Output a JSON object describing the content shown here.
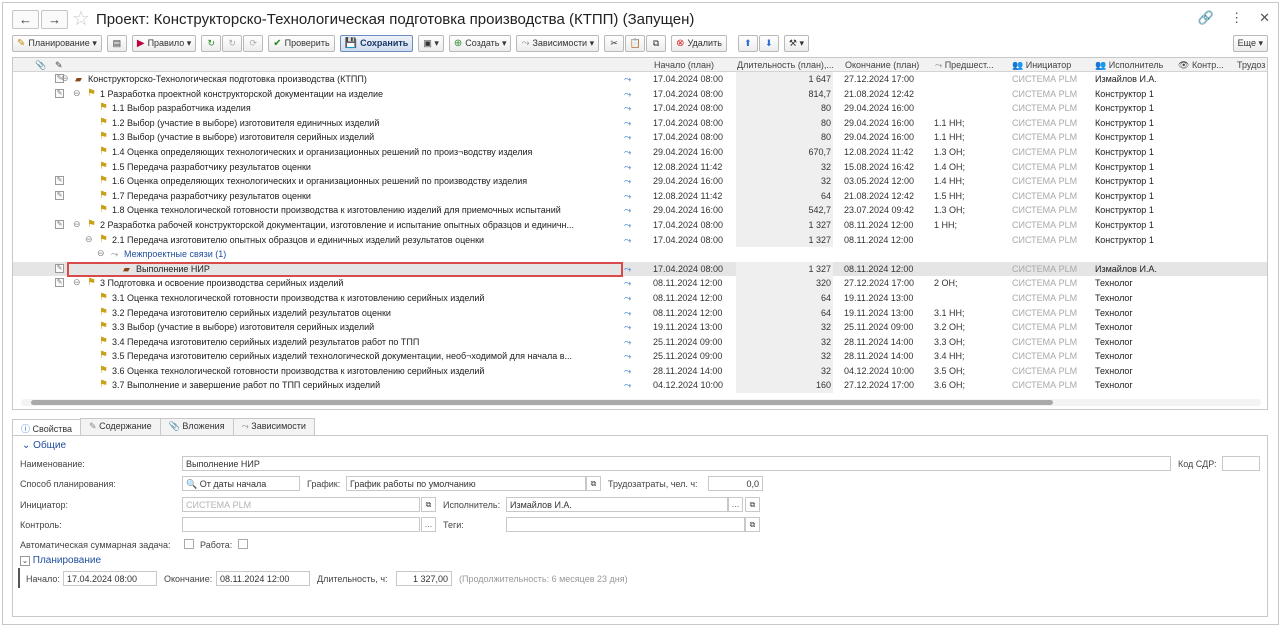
{
  "title": "Проект: Конструкторско-Технологическая подготовка производства (КТПП) (Запущен)",
  "toolbar": {
    "planning": "Планирование",
    "rule": "Правило",
    "check": "Проверить",
    "save": "Сохранить",
    "create": "Создать",
    "deps": "Зависимости",
    "delete": "Удалить",
    "more": "Еще"
  },
  "columns": {
    "start": "Начало (план)",
    "duration": "Длительность (план),...",
    "end": "Окончание (план)",
    "pred": "Предшест...",
    "initiator": "Инициатор",
    "executor": "Исполнитель",
    "control": "Контр...",
    "labor": "Трудоз"
  },
  "rows": [
    {
      "name": "Конструкторско-Технологическая подготовка производства (КТПП)",
      "start": "17.04.2024 08:00",
      "duration": "1 647",
      "end": "27.12.2024 17:00",
      "pred": "",
      "initiator": "СИСТЕМА PLM",
      "executor": "Измайлов И.А."
    },
    {
      "name": "1 Разработка проектной конструкторской документации на изделие",
      "start": "17.04.2024 08:00",
      "duration": "814,7",
      "end": "21.08.2024 12:42",
      "pred": "",
      "initiator": "СИСТЕМА PLM",
      "executor": "Конструктор 1"
    },
    {
      "name": "1.1 Выбор разработчика изделия",
      "start": "17.04.2024 08:00",
      "duration": "80",
      "end": "29.04.2024 16:00",
      "pred": "",
      "initiator": "СИСТЕМА PLM",
      "executor": "Конструктор 1"
    },
    {
      "name": "1.2 Выбор (участие в выборе) изготовителя единичных изделий",
      "start": "17.04.2024 08:00",
      "duration": "80",
      "end": "29.04.2024 16:00",
      "pred": "1.1 НН;",
      "initiator": "СИСТЕМА PLM",
      "executor": "Конструктор 1"
    },
    {
      "name": "1.3 Выбор (участие в выборе) изготовителя серийных изделий",
      "start": "17.04.2024 08:00",
      "duration": "80",
      "end": "29.04.2024 16:00",
      "pred": "1.1 НН;",
      "initiator": "СИСТЕМА PLM",
      "executor": "Конструктор 1"
    },
    {
      "name": "1.4 Оценка определяющих технологических и организационных решений по произ¬водству изделия",
      "start": "29.04.2024 16:00",
      "duration": "670,7",
      "end": "12.08.2024 11:42",
      "pred": "1.3 ОН;",
      "initiator": "СИСТЕМА PLM",
      "executor": "Конструктор 1"
    },
    {
      "name": "1.5 Передача разработчику результатов оценки",
      "start": "12.08.2024 11:42",
      "duration": "32",
      "end": "15.08.2024 16:42",
      "pred": "1.4 ОН;",
      "initiator": "СИСТЕМА PLM",
      "executor": "Конструктор 1"
    },
    {
      "name": "1.6 Оценка определяющих технологических и организационных решений по производству изделия",
      "start": "29.04.2024 16:00",
      "duration": "32",
      "end": "03.05.2024 12:00",
      "pred": "1.4 НН;",
      "initiator": "СИСТЕМА PLM",
      "executor": "Конструктор 1"
    },
    {
      "name": "1.7 Передача разработчику результатов оценки",
      "start": "12.08.2024 11:42",
      "duration": "64",
      "end": "21.08.2024 12:42",
      "pred": "1.5 НН;",
      "initiator": "СИСТЕМА PLM",
      "executor": "Конструктор 1"
    },
    {
      "name": "1.8 Оценка технологической готовности производства к изготовлению изделий для приемочных испытаний",
      "start": "29.04.2024 16:00",
      "duration": "542,7",
      "end": "23.07.2024 09:42",
      "pred": "1.3 ОН;",
      "initiator": "СИСТЕМА PLM",
      "executor": "Конструктор 1"
    },
    {
      "name": "2 Разработка рабочей конструкторской документации, изготовление и испытание опытных образцов и единичн...",
      "start": "17.04.2024 08:00",
      "duration": "1 327",
      "end": "08.11.2024 12:00",
      "pred": "1 НН;",
      "initiator": "СИСТЕМА PLM",
      "executor": "Конструктор 1"
    },
    {
      "name": "2.1 Передача изготовителю опытных образцов и единичных изделий результатов оценки",
      "start": "17.04.2024 08:00",
      "duration": "1 327",
      "end": "08.11.2024 12:00",
      "pred": "",
      "initiator": "СИСТЕМА PLM",
      "executor": "Конструктор 1"
    },
    {
      "name": "Межпроектные связи (1)",
      "start": "",
      "duration": "",
      "end": "",
      "pred": "",
      "initiator": "",
      "executor": ""
    },
    {
      "name": "Выполнение НИР",
      "start": "17.04.2024 08:00",
      "duration": "1 327",
      "end": "08.11.2024 12:00",
      "pred": "",
      "initiator": "СИСТЕМА PLM",
      "executor": "Измайлов И.А."
    },
    {
      "name": "3 Подготовка и освоение производства серийных изделий",
      "start": "08.11.2024 12:00",
      "duration": "320",
      "end": "27.12.2024 17:00",
      "pred": "2 ОН;",
      "initiator": "СИСТЕМА PLM",
      "executor": "Технолог"
    },
    {
      "name": "3.1 Оценка технологической готовности производства к изготовлению серийных изделий",
      "start": "08.11.2024 12:00",
      "duration": "64",
      "end": "19.11.2024 13:00",
      "pred": "",
      "initiator": "СИСТЕМА PLM",
      "executor": "Технолог"
    },
    {
      "name": "3.2 Передача изготовителю серийных изделий результатов оценки",
      "start": "08.11.2024 12:00",
      "duration": "64",
      "end": "19.11.2024 13:00",
      "pred": "3.1 НН;",
      "initiator": "СИСТЕМА PLM",
      "executor": "Технолог"
    },
    {
      "name": "3.3 Выбор (участие в выборе) изготовителя серийных изделий",
      "start": "19.11.2024 13:00",
      "duration": "32",
      "end": "25.11.2024 09:00",
      "pred": "3.2 ОН;",
      "initiator": "СИСТЕМА PLM",
      "executor": "Технолог"
    },
    {
      "name": "3.4 Передача изготовителю серийных изделий результатов работ по ТПП",
      "start": "25.11.2024 09:00",
      "duration": "32",
      "end": "28.11.2024 14:00",
      "pred": "3.3 ОН;",
      "initiator": "СИСТЕМА PLM",
      "executor": "Технолог"
    },
    {
      "name": "3.5 Передача изготовителю серийных изделий технологической документации, необ¬ходимой для начала в...",
      "start": "25.11.2024 09:00",
      "duration": "32",
      "end": "28.11.2024 14:00",
      "pred": "3.4 НН;",
      "initiator": "СИСТЕМА PLM",
      "executor": "Технолог"
    },
    {
      "name": "3.6 Оценка технологической готовности производства к изготовлению серийных изделий",
      "start": "28.11.2024 14:00",
      "duration": "32",
      "end": "04.12.2024 10:00",
      "pred": "3.5 ОН;",
      "initiator": "СИСТЕМА PLM",
      "executor": "Технолог"
    },
    {
      "name": "3.7 Выполнение и завершение работ по ТПП серийных изделий",
      "start": "04.12.2024 10:00",
      "duration": "160",
      "end": "27.12.2024 17:00",
      "pred": "3.6 ОН;",
      "initiator": "СИСТЕМА PLM",
      "executor": "Технолог"
    }
  ],
  "tabs": [
    "Свойства",
    "Содержание",
    "Вложения",
    "Зависимости"
  ],
  "form": {
    "general": "Общие",
    "name_label": "Наименование:",
    "name_value": "Выполнение НИР",
    "sdr_label": "Код СДР:",
    "plan_method_label": "Способ планирования:",
    "plan_method_value": "От даты начала",
    "schedule_label": "График:",
    "schedule_value": "График работы по умолчанию",
    "labor_label": "Трудозатраты, чел. ч:",
    "labor_value": "0,0",
    "initiator_label": "Инициатор:",
    "initiator_value": "СИСТЕМА PLM",
    "executor_label": "Исполнитель:",
    "executor_value": "Измайлов И.А.",
    "control_label": "Контроль:",
    "tags_label": "Теги:",
    "auto_label": "Автоматическая суммарная задача:",
    "work_label": "Работа:",
    "planning": "Планирование",
    "start_label": "Начало:",
    "start_value": "17.04.2024 08:00",
    "end_label": "Окончание:",
    "end_value": "08.11.2024 12:00",
    "dur_label": "Длительность, ч:",
    "dur_value": "1 327,00",
    "dur_note": "(Продолжительность: 6 месяцев 23 дня)"
  }
}
